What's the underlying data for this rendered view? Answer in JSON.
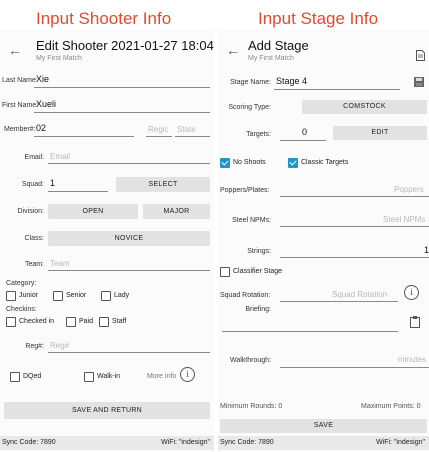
{
  "left_caption": "Input Shooter Info",
  "right_caption": "Input Stage Info",
  "shooter": {
    "title": "Edit Shooter 2021-01-27 18:04",
    "subtitle": "My First Match",
    "last_name_label": "Last Name:",
    "last_name_value": "Xie",
    "first_name_label": "First Name:",
    "first_name_value": "Xueli",
    "member_label": "Member#:",
    "member_value": "02",
    "region_placeholder": "Regic",
    "state_placeholder": "State",
    "email_label": "Email:",
    "email_placeholder": "Email",
    "squad_label": "Squad:",
    "squad_value": "1",
    "select_button": "SELECT",
    "division_label": "Division:",
    "division_button": "OPEN",
    "power_button": "MAJOR",
    "class_label": "Class:",
    "class_button": "NOVICE",
    "team_label": "Team:",
    "team_placeholder": "Team",
    "category_label": "Category:",
    "junior_label": "Junior",
    "senior_label": "Senior",
    "lady_label": "Lady",
    "checkins_label": "Checkins:",
    "checkedin_label": "Checked in",
    "paid_label": "Paid",
    "staff_label": "Staff",
    "reg_label": "Reg#:",
    "reg_placeholder": "Reg#",
    "dqed_label": "DQed",
    "walkin_label": "Walk-in",
    "more_info_label": "More info",
    "info_icon_glyph": "i",
    "save_return_button": "SAVE AND RETURN",
    "sync_code": "Sync Code: 7890",
    "wifi": "WiFi: \"indesign\""
  },
  "stage": {
    "title": "Add Stage",
    "subtitle": "My First Match",
    "stage_name_label": "Stage Name:",
    "stage_name_value": "Stage 4",
    "scoring_type_label": "Scoring Type:",
    "scoring_type_button": "COMSTOCK",
    "targets_label": "Targets:",
    "targets_value": "0",
    "edit_button": "EDIT",
    "no_shoots_label": "No Shoots",
    "classic_targets_label": "Classic Targets",
    "poppers_label": "Poppers/Plates:",
    "poppers_placeholder": "Poppers",
    "steel_npm_label": "Steel NPMs:",
    "steel_npm_placeholder": "Steel NPMs",
    "strings_label": "Strings:",
    "strings_value": "1",
    "classifier_label": "Classifier Stage",
    "squad_rotation_label": "Squad Rotation:",
    "squad_rotation_placeholder": "Squad Rotation",
    "info_icon_glyph": "i",
    "briefing_label": "Briefing:",
    "walkthrough_label": "Walkthrough:",
    "walkthrough_placeholder": "minutes",
    "min_rounds": "Minimum Rounds: 0",
    "max_points": "Maximum Points: 0",
    "save_button": "SAVE",
    "sync_code": "Sync Code: 7890",
    "wifi": "WiFi: \"indesign\""
  },
  "colors": {
    "caption": "#e24a2c",
    "checkbox_checked": "#2196c9",
    "button_bg": "#e2e2e2"
  }
}
